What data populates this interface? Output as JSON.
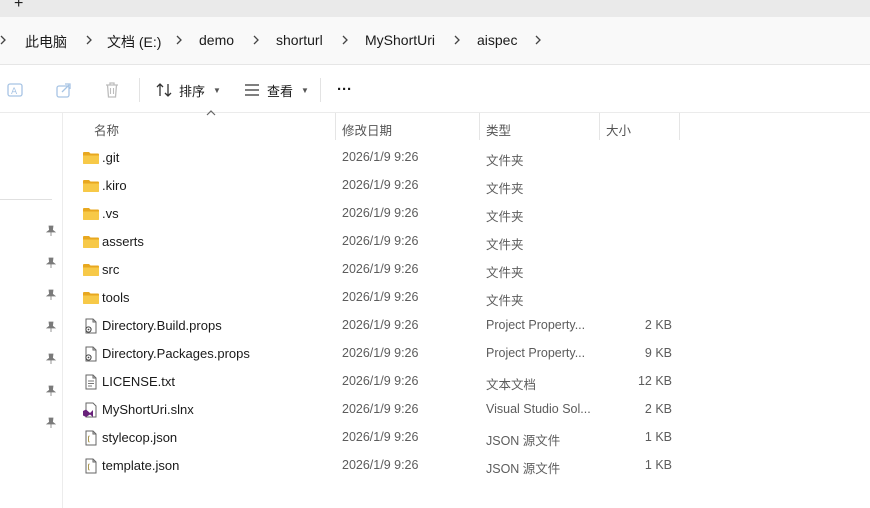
{
  "tabstrip": {
    "new_tab": "+"
  },
  "breadcrumb": [
    "此电脑",
    "文档 (E:)",
    "demo",
    "shorturl",
    "MyShortUri",
    "aispec"
  ],
  "toolbar": {
    "sort_label": "排序",
    "view_label": "查看",
    "more_label": "···"
  },
  "columns": {
    "name": "名称",
    "modified": "修改日期",
    "type": "类型",
    "size": "大小"
  },
  "files": [
    {
      "icon": "folder-icon",
      "name": ".git",
      "modified": "2026/1/9 9:26",
      "type": "文件夹",
      "size": ""
    },
    {
      "icon": "folder-icon",
      "name": ".kiro",
      "modified": "2026/1/9 9:26",
      "type": "文件夹",
      "size": ""
    },
    {
      "icon": "folder-icon",
      "name": ".vs",
      "modified": "2026/1/9 9:26",
      "type": "文件夹",
      "size": ""
    },
    {
      "icon": "folder-icon",
      "name": "asserts",
      "modified": "2026/1/9 9:26",
      "type": "文件夹",
      "size": ""
    },
    {
      "icon": "folder-icon",
      "name": "src",
      "modified": "2026/1/9 9:26",
      "type": "文件夹",
      "size": ""
    },
    {
      "icon": "folder-icon",
      "name": "tools",
      "modified": "2026/1/9 9:26",
      "type": "文件夹",
      "size": ""
    },
    {
      "icon": "props-file-icon",
      "name": "Directory.Build.props",
      "modified": "2026/1/9 9:26",
      "type": "Project Property...",
      "size": "2 KB"
    },
    {
      "icon": "props-file-icon",
      "name": "Directory.Packages.props",
      "modified": "2026/1/9 9:26",
      "type": "Project Property...",
      "size": "9 KB"
    },
    {
      "icon": "text-file-icon",
      "name": "LICENSE.txt",
      "modified": "2026/1/9 9:26",
      "type": "文本文档",
      "size": "12 KB"
    },
    {
      "icon": "visual-studio-solution-icon",
      "name": "MyShortUri.slnx",
      "modified": "2026/1/9 9:26",
      "type": "Visual Studio Sol...",
      "size": "2 KB"
    },
    {
      "icon": "json-file-icon",
      "name": "stylecop.json",
      "modified": "2026/1/9 9:26",
      "type": "JSON 源文件",
      "size": "1 KB"
    },
    {
      "icon": "json-file-icon",
      "name": "template.json",
      "modified": "2026/1/9 9:26",
      "type": "JSON 源文件",
      "size": "1 KB"
    }
  ],
  "colors": {
    "folder": "#f7c948",
    "folder_dark": "#e8a820",
    "accent": "#0067c0",
    "vs_purple": "#68217a"
  }
}
